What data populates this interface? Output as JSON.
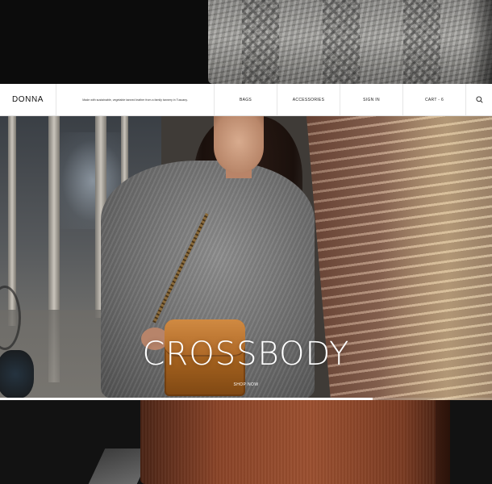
{
  "brand": {
    "name": "DONNA",
    "tagline": "Made with sustainable, vegetable tanned leather from a family tannery in Tuscany."
  },
  "nav": {
    "items": [
      {
        "label": "BAGS"
      },
      {
        "label": "ACCESSORIES"
      },
      {
        "label": "SIGN IN"
      },
      {
        "label": "CART - 6"
      }
    ],
    "search_icon": "search-icon"
  },
  "hero": {
    "headline": "CROSSBODY",
    "cta": "SHOP NOW",
    "slide_progress": 0.757,
    "image": "woman-with-crossbody-bag"
  },
  "images": {
    "top": "knit-sweater-closeup",
    "bottom": "leather-bag-closeup"
  },
  "colors": {
    "navbar_bg": "#ffffff",
    "text_on_image": "#ffffff",
    "progress": "#ffffff"
  }
}
